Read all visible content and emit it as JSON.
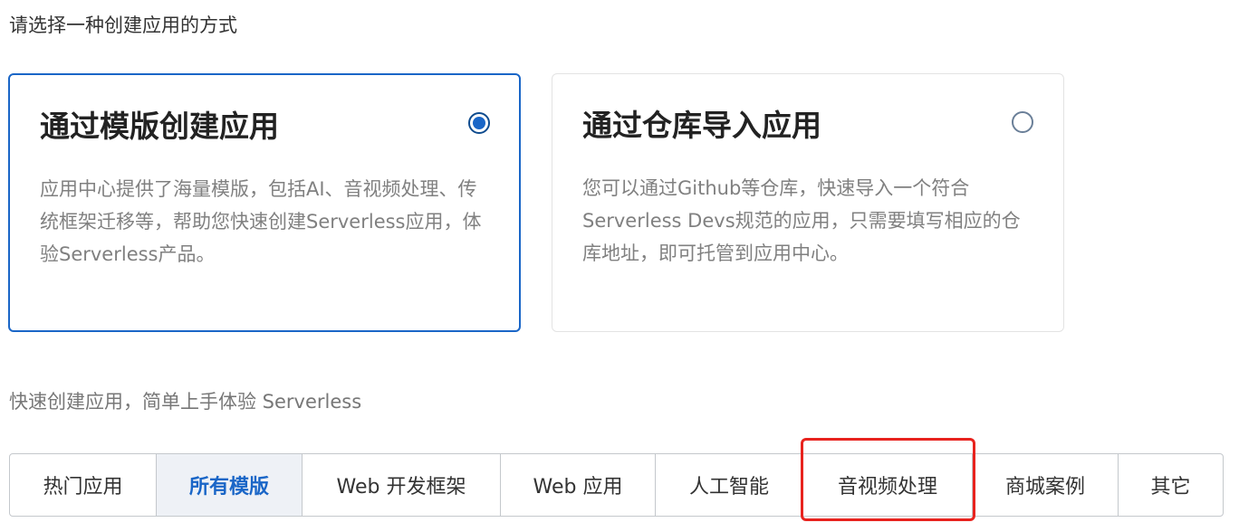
{
  "prompt": "请选择一种创建应用的方式",
  "cards": [
    {
      "title": "通过模版创建应用",
      "description": "应用中心提供了海量模版，包括AI、音视频处理、传统框架迁移等，帮助您快速创建Serverless应用，体验Serverless产品。",
      "selected": true
    },
    {
      "title": "通过仓库导入应用",
      "description": "您可以通过Github等仓库，快速导入一个符合Serverless Devs规范的应用，只需要填写相应的仓库地址，即可托管到应用中心。",
      "selected": false
    }
  ],
  "subtitle": "快速创建应用，简单上手体验 Serverless",
  "tabs": [
    {
      "label": "热门应用"
    },
    {
      "label": "所有模版",
      "active": true
    },
    {
      "label": "Web 开发框架"
    },
    {
      "label": "Web 应用"
    },
    {
      "label": "人工智能"
    },
    {
      "label": "音视频处理",
      "highlighted": true
    },
    {
      "label": "商城案例"
    },
    {
      "label": "其它"
    }
  ],
  "colors": {
    "accent": "#1a66c7",
    "highlight": "#e8231e"
  }
}
